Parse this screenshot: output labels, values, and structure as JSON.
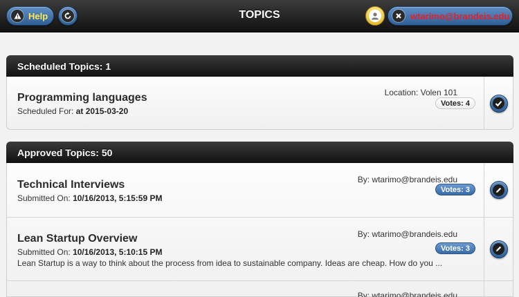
{
  "header": {
    "title": "TOPICS",
    "help_label": "Help",
    "user_label": "wtarimo@brandeis.edu"
  },
  "scheduled": {
    "heading": "Scheduled Topics: 1",
    "items": [
      {
        "title": "Programming languages",
        "meta_prefix": "Scheduled For:",
        "meta_value": "at 2015-03-20",
        "location": "Location: Volen 101",
        "votes": "Votes: 4",
        "action_icon": "checkmark-icon"
      }
    ]
  },
  "approved": {
    "heading": "Approved Topics: 50",
    "items": [
      {
        "title": "Technical Interviews",
        "meta_prefix": "Submitted On:",
        "meta_value": "10/16/2013, 5:15:59 PM",
        "by": "By: wtarimo@brandeis.edu",
        "votes": "Votes: 3",
        "description": "",
        "action_icon": "pencil-icon"
      },
      {
        "title": "Lean Startup Overview",
        "meta_prefix": "Submitted On:",
        "meta_value": "10/16/2013, 5:10:15 PM",
        "by": "By: wtarimo@brandeis.edu",
        "votes": "Votes: 3",
        "description": "Lean Startup is a way to think about the process from idea to sustainable company. Ideas are cheap. How do you ...",
        "action_icon": "pencil-icon"
      },
      {
        "by": "By: wtarimo@brandeis.edu"
      }
    ]
  },
  "colors": {
    "help_text": "#ffe84d",
    "user_text": "#e8202a",
    "button_blue": "#3a6aa3"
  }
}
